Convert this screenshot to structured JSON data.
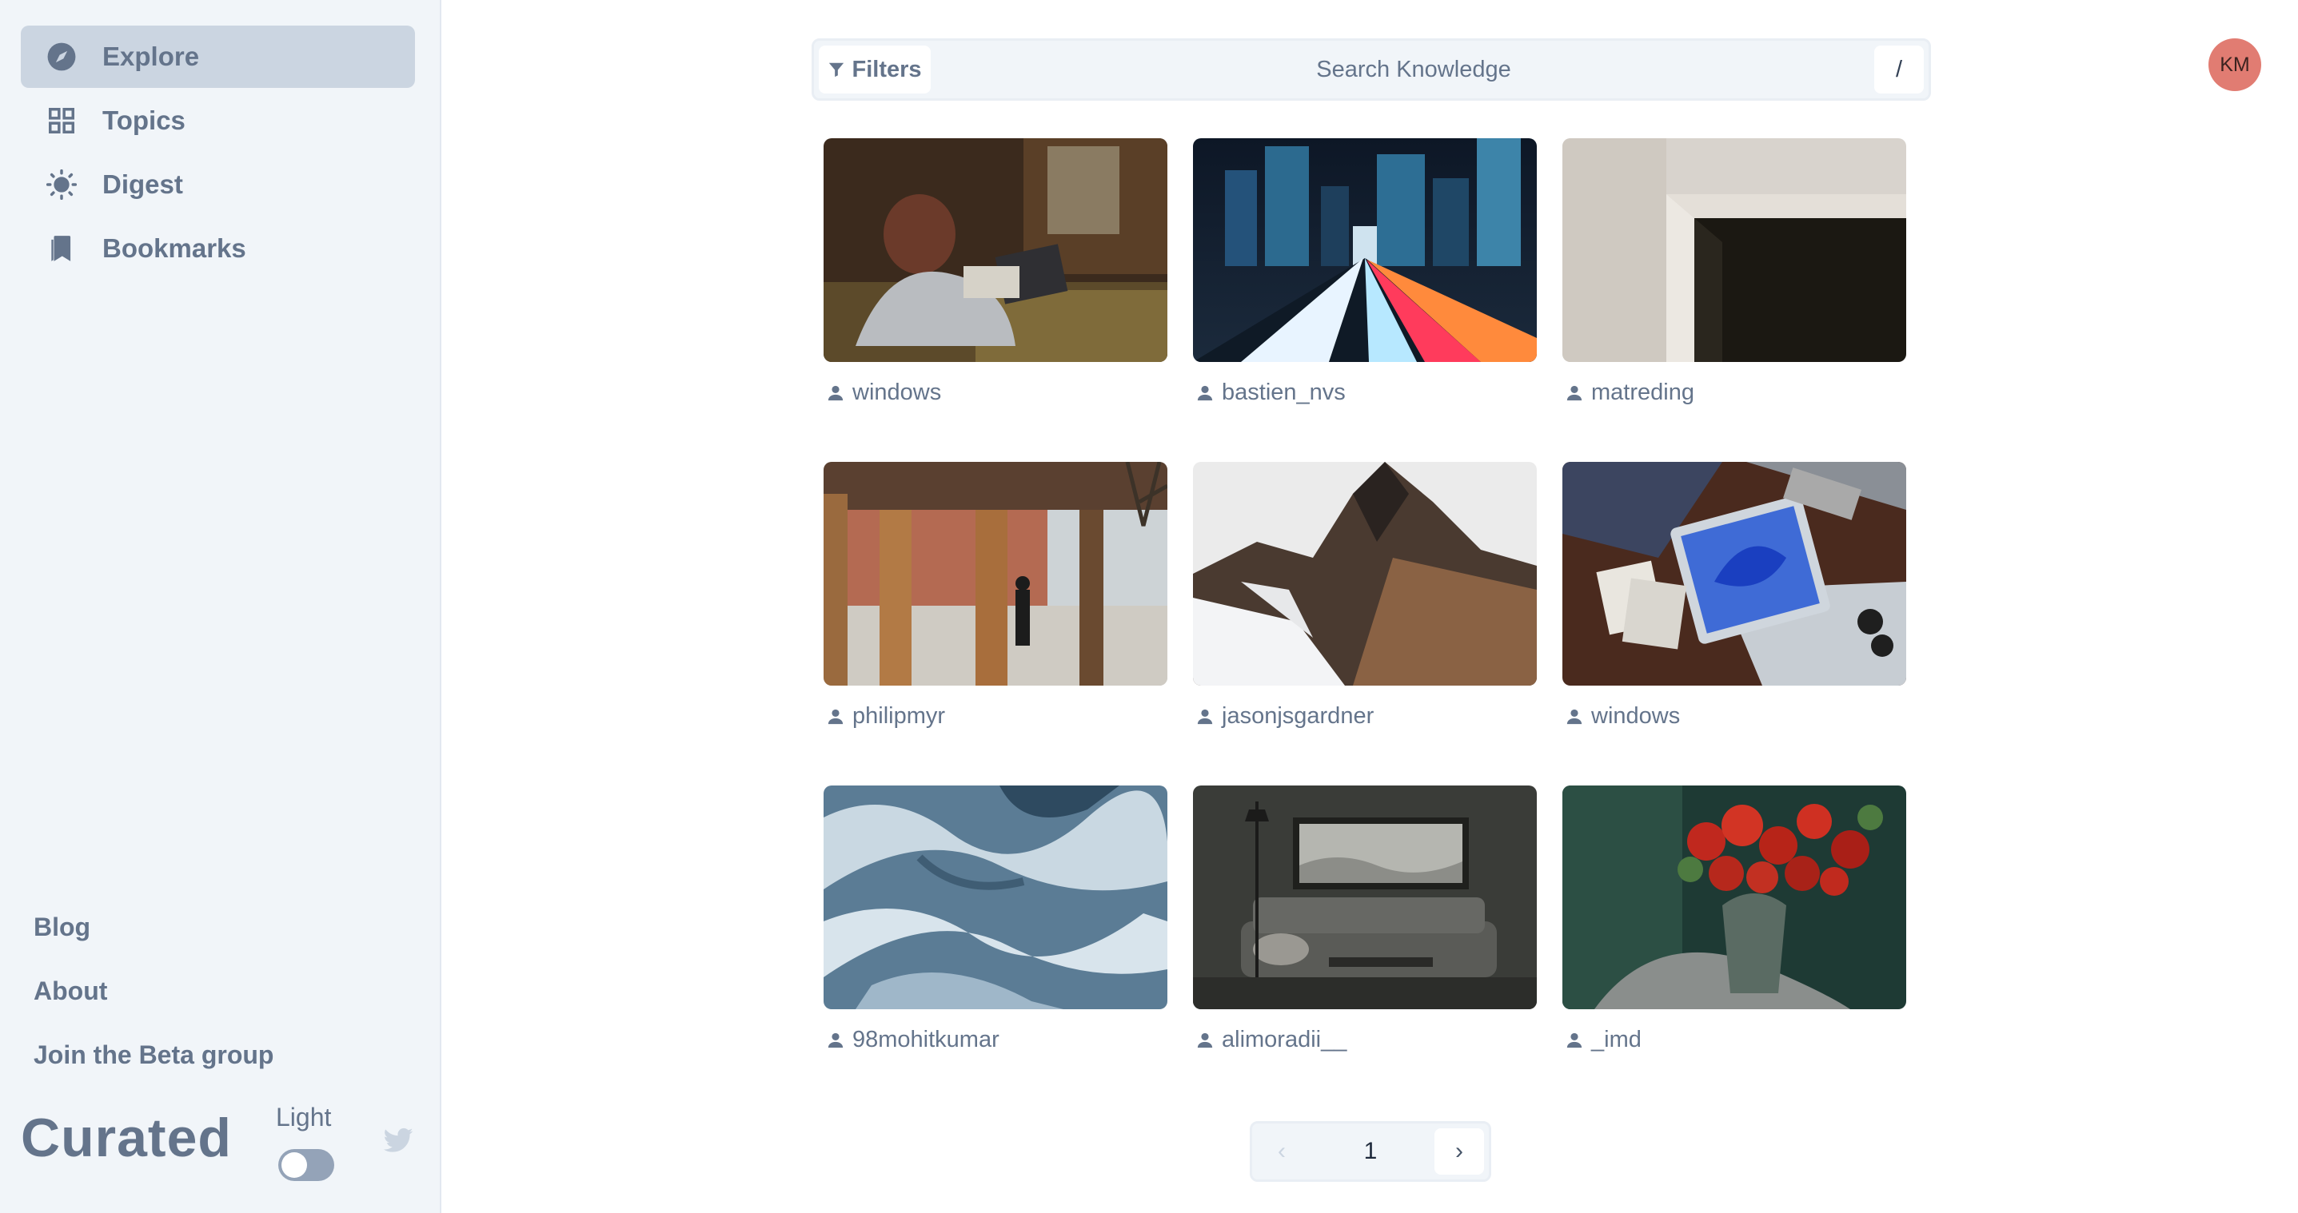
{
  "sidebar": {
    "nav": [
      {
        "label": "Explore",
        "icon": "compass-icon",
        "active": true
      },
      {
        "label": "Topics",
        "icon": "grid-icon"
      },
      {
        "label": "Digest",
        "icon": "sun-icon"
      },
      {
        "label": "Bookmarks",
        "icon": "bookmarks-icon"
      }
    ],
    "links": [
      "Blog",
      "About",
      "Join the Beta group"
    ],
    "brand": "Curated",
    "theme_label": "Light"
  },
  "search": {
    "filters_label": "Filters",
    "placeholder": "Search Knowledge",
    "shortcut": "/"
  },
  "user": {
    "initials": "KM",
    "avatar_color": "#e17c72"
  },
  "photos": [
    {
      "author": "windows"
    },
    {
      "author": "bastien_nvs"
    },
    {
      "author": "matreding"
    },
    {
      "author": "philipmyr"
    },
    {
      "author": "jasonjsgardner"
    },
    {
      "author": "windows"
    },
    {
      "author": "98mohitkumar"
    },
    {
      "author": "alimoradii__"
    },
    {
      "author": "_imd"
    }
  ],
  "pagination": {
    "current": "1",
    "prev": "‹",
    "next": "›"
  },
  "colors": {
    "sidebar_bg": "#f1f5f9",
    "active_nav": "#cbd5e1",
    "text": "#64748b"
  }
}
